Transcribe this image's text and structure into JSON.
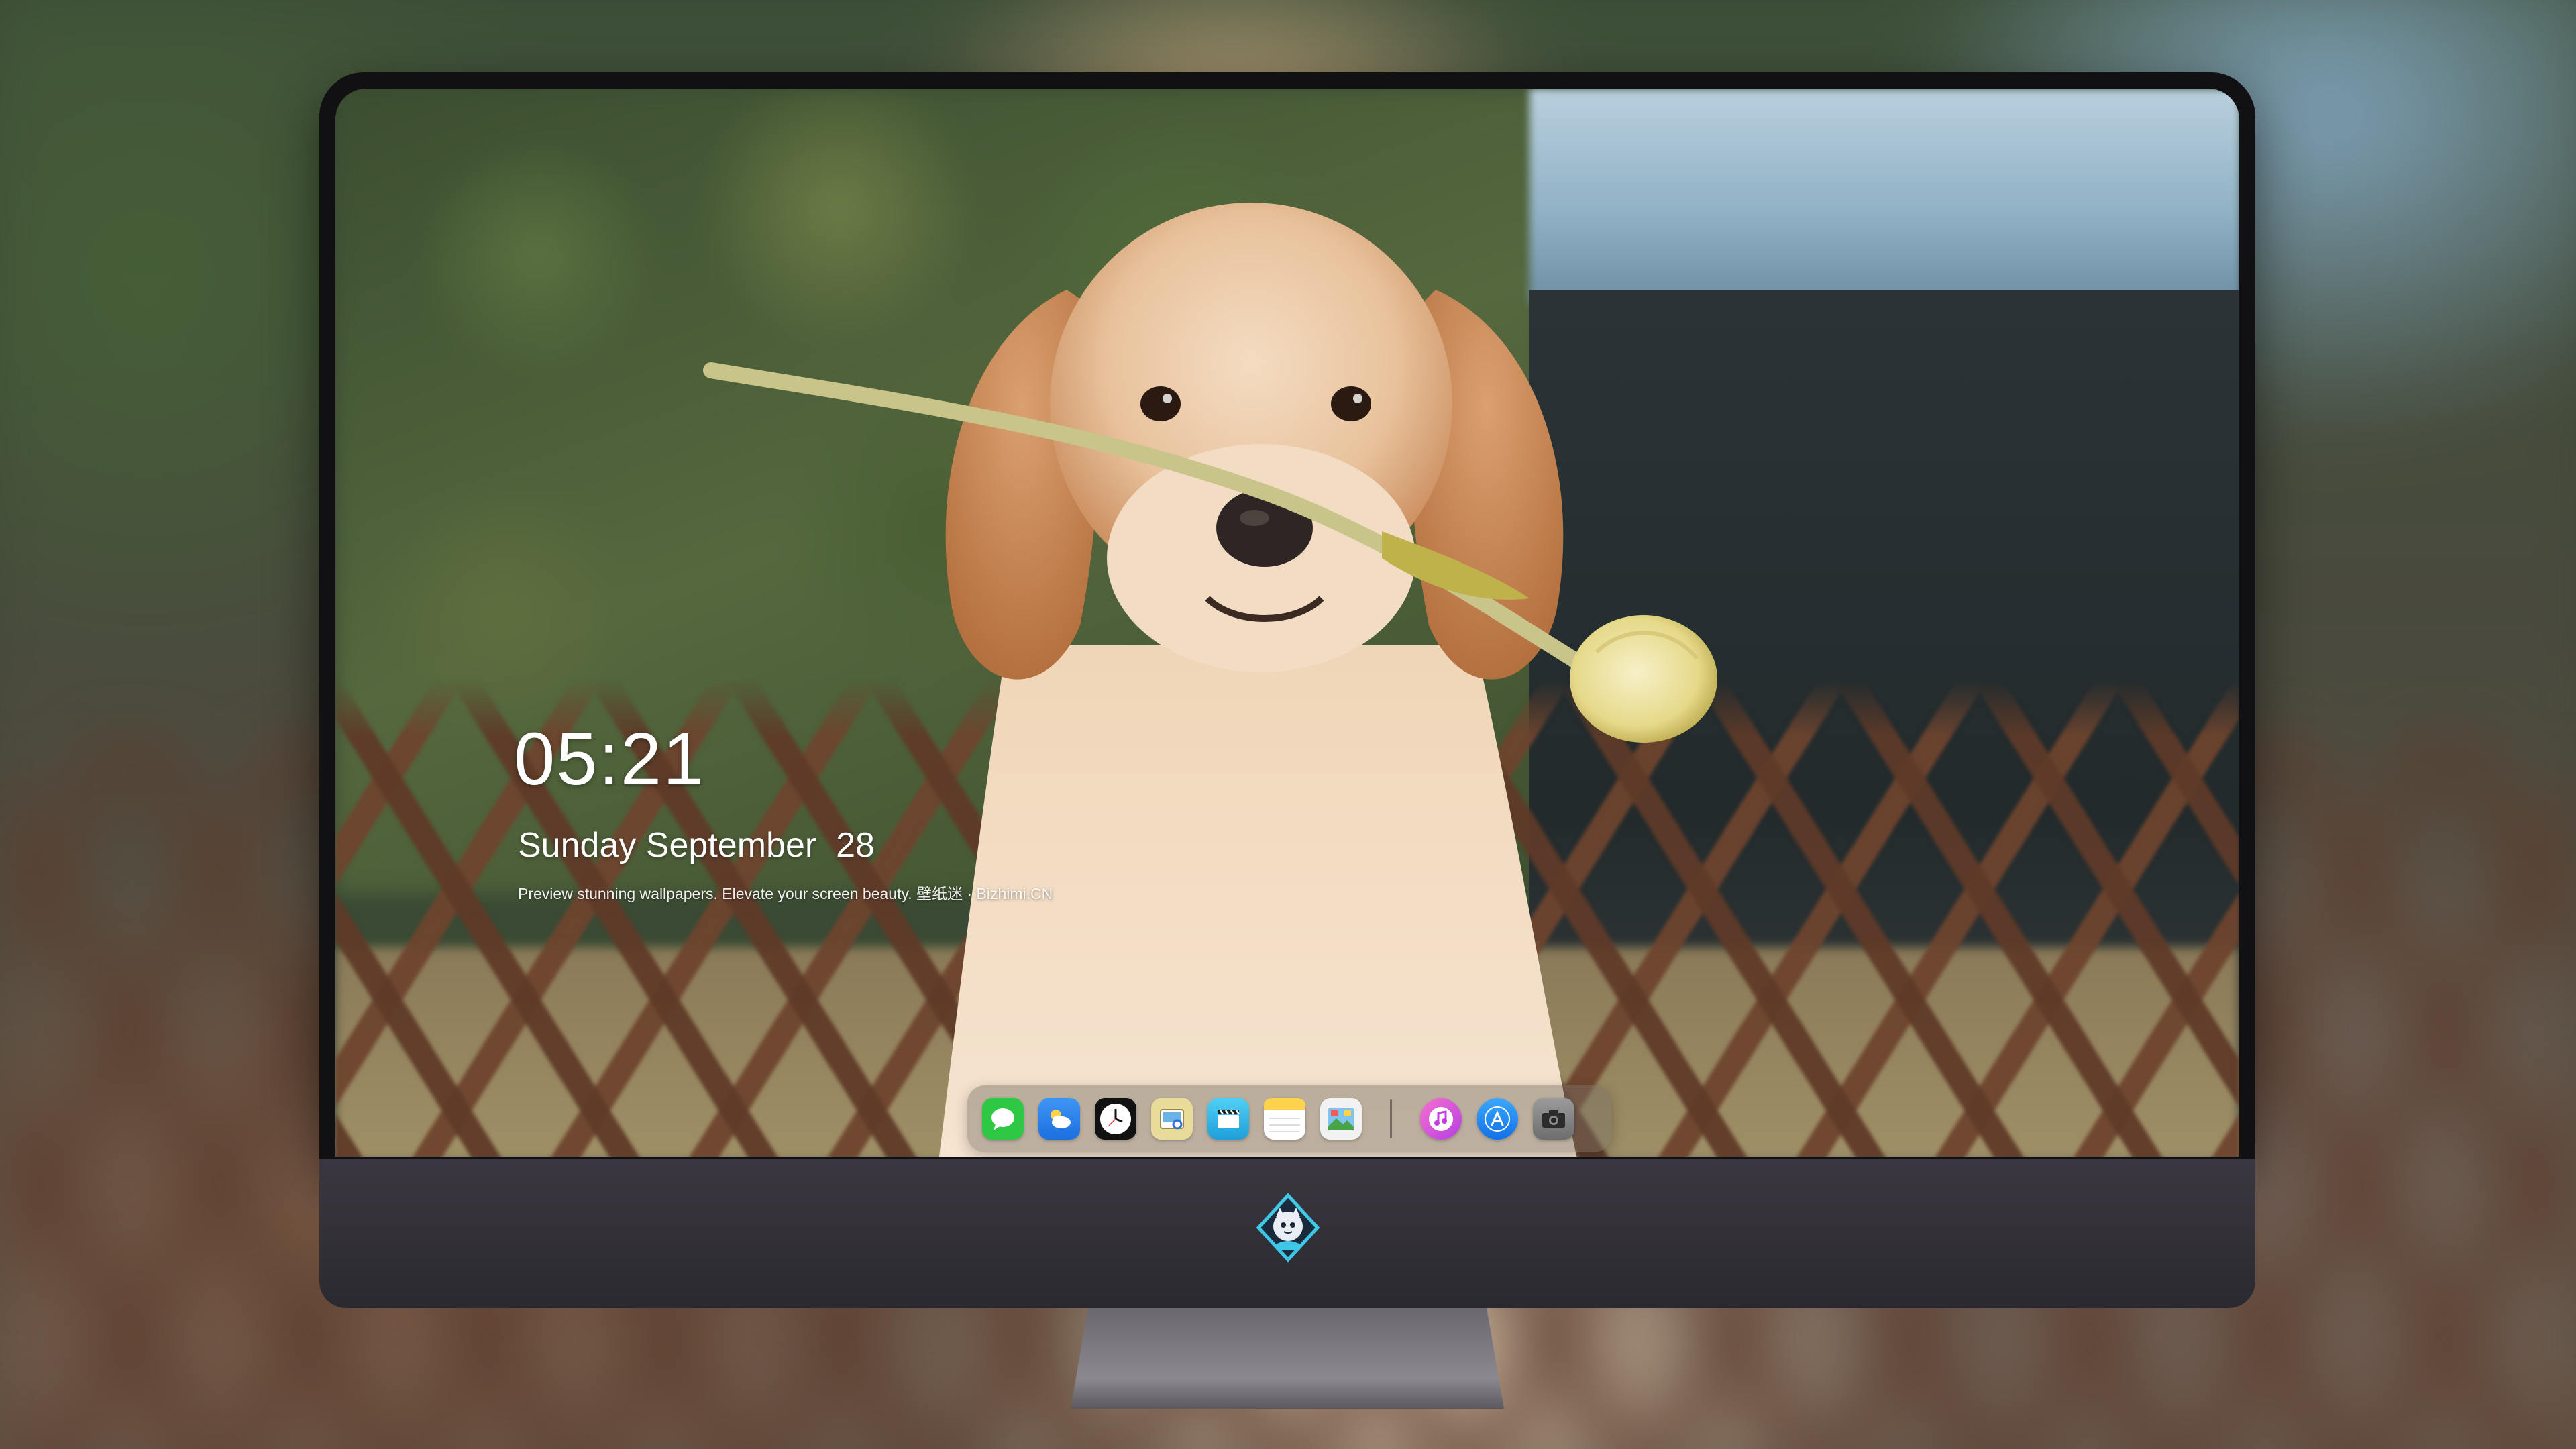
{
  "lockscreen": {
    "time": "05:21",
    "date": "Sunday September  28",
    "tagline": "Preview stunning wallpapers. Elevate your screen beauty. 壁纸迷 · Bizhimi.CN"
  },
  "wallpaper": {
    "subject": "golden retriever puppy holding a yellow tulip"
  },
  "dock": {
    "apps": [
      {
        "name": "Messages",
        "icon": "messages-icon",
        "color": "#2fc845"
      },
      {
        "name": "Weather",
        "icon": "weather-icon",
        "color": "#3a8ef0"
      },
      {
        "name": "Clock",
        "icon": "clock-icon",
        "color": "#111111"
      },
      {
        "name": "Preview",
        "icon": "preview-icon",
        "color": "#e9dc9a"
      },
      {
        "name": "Clips",
        "icon": "clapperboard-icon",
        "color": "#33b8e8"
      },
      {
        "name": "Notes",
        "icon": "notes-icon",
        "color": "#fbd34d"
      },
      {
        "name": "Photos",
        "icon": "photos-icon",
        "color": "#f2f2f2"
      },
      {
        "name": "iTunes",
        "icon": "music-icon",
        "color": "#e552d6"
      },
      {
        "name": "App Store",
        "icon": "app-store-icon",
        "color": "#1d8cf8"
      },
      {
        "name": "Camera",
        "icon": "camera-icon",
        "color": "#8a8a8a"
      }
    ]
  },
  "monitor": {
    "chin_logo": "bizhimi-mascot-logo"
  }
}
